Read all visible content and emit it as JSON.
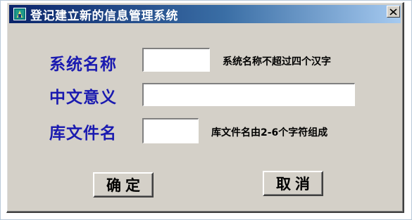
{
  "window": {
    "title": "登记建立新的信息管理系统",
    "icon": "app-icon",
    "close_icon": "close-icon"
  },
  "form": {
    "system_name": {
      "label": "系统名称",
      "value": "",
      "hint": "系统名称不超过四个汉字"
    },
    "chinese_meaning": {
      "label": "中文意义",
      "value": ""
    },
    "library_file_name": {
      "label": "库文件名",
      "value": "",
      "hint": "库文件名由2-6个字符组成"
    }
  },
  "buttons": {
    "ok_label": "确定",
    "cancel_label": "取消"
  },
  "colors": {
    "label_text": "#1a1ab0",
    "title_bar_start": "#0a246a",
    "title_bar_end": "#a6caf0",
    "window_face": "#d4d0c8"
  }
}
